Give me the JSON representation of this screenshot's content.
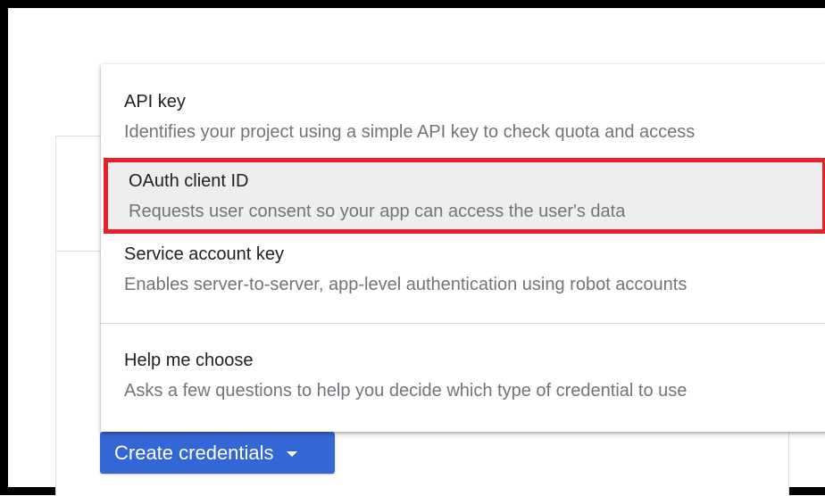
{
  "menu": {
    "items": [
      {
        "title": "API key",
        "description": "Identifies your project using a simple API key to check quota and access"
      },
      {
        "title": "OAuth client ID",
        "description": "Requests user consent so your app can access the user's data",
        "highlighted": true
      },
      {
        "title": "Service account key",
        "description": "Enables server-to-server, app-level authentication using robot accounts"
      },
      {
        "title": "Help me choose",
        "description": "Asks a few questions to help you decide which type of credential to use"
      }
    ]
  },
  "button": {
    "label": "Create credentials",
    "icon": "caret-down-icon"
  },
  "colors": {
    "primary_button": "#3367d6",
    "highlight_border": "#e8202a",
    "highlight_background": "#eeeeee"
  }
}
